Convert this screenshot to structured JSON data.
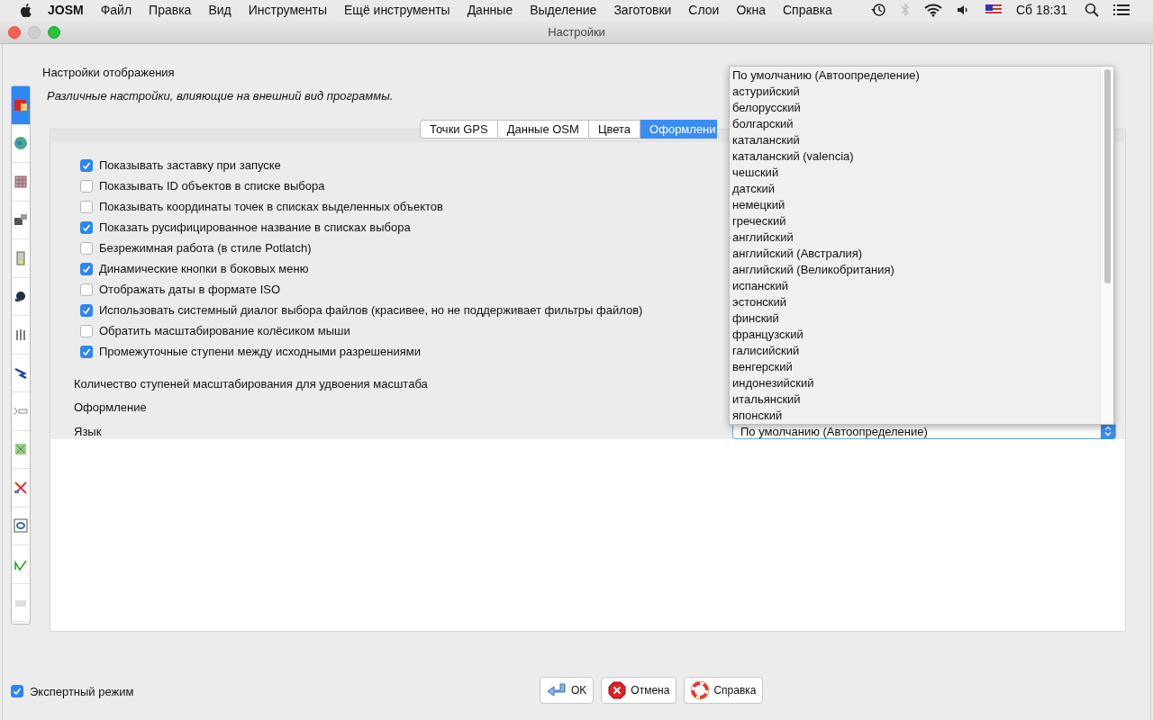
{
  "menu_bar": {
    "app": "JOSM",
    "items": [
      "Файл",
      "Правка",
      "Вид",
      "Инструменты",
      "Ещё инструменты",
      "Данные",
      "Выделение",
      "Заготовки",
      "Слои",
      "Окна",
      "Справка"
    ],
    "clock": "Сб 18:31"
  },
  "window": {
    "title": "Настройки"
  },
  "sidebar": {
    "items": [
      {
        "kind": "display",
        "selected": true
      },
      {
        "kind": "globe",
        "selected": false
      },
      {
        "kind": "grid",
        "selected": false
      },
      {
        "kind": "plugin",
        "selected": false
      },
      {
        "kind": "file",
        "selected": false
      },
      {
        "kind": "satellite",
        "selected": false
      },
      {
        "kind": "bars",
        "selected": false
      },
      {
        "kind": "arrow",
        "selected": false
      },
      {
        "kind": "dots",
        "selected": false
      },
      {
        "kind": "map",
        "selected": false
      },
      {
        "kind": "tools",
        "selected": false
      },
      {
        "kind": "ring",
        "selected": false
      },
      {
        "kind": "line",
        "selected": false
      },
      {
        "kind": "blank",
        "selected": false
      }
    ]
  },
  "header": {
    "title": "Настройки отображения",
    "description": "Различные настройки, влияющие на внешний вид программы."
  },
  "tabs": [
    {
      "label": "Точки GPS",
      "selected": false
    },
    {
      "label": "Данные OSM",
      "selected": false
    },
    {
      "label": "Цвета",
      "selected": false
    },
    {
      "label": "Оформлени",
      "selected": true
    }
  ],
  "options": [
    {
      "label": "Показывать заставку при запуске",
      "checked": true
    },
    {
      "label": "Показывать ID объектов в списке выбора",
      "checked": false
    },
    {
      "label": "Показывать координаты точек в списках выделенных объектов",
      "checked": false
    },
    {
      "label": "Показать русифицированное название в списках выбора",
      "checked": true
    },
    {
      "label": "Безрежимная работа (в стиле Potlatch)",
      "checked": false
    },
    {
      "label": "Динамические кнопки в боковых меню",
      "checked": true
    },
    {
      "label": "Отображать даты в формате ISO",
      "checked": false
    },
    {
      "label": "Использовать системный диалог выбора файлов (красивее, но не поддерживает фильтры файлов)",
      "checked": true
    },
    {
      "label": "Обратить масштабирование колёсиком мыши",
      "checked": false
    },
    {
      "label": "Промежуточные ступени между исходными разрешениями",
      "checked": true
    }
  ],
  "fields": [
    {
      "label": "Количество ступеней масштабирования для удвоения масштаба"
    },
    {
      "label": "Оформление"
    },
    {
      "label": "Язык",
      "value": "По умолчанию (Автоопределение)"
    }
  ],
  "language_list": [
    "По умолчанию (Автоопределение)",
    "астурийский",
    "белорусский",
    "болгарский",
    "каталанский",
    "каталанский (valencia)",
    "чешский",
    "датский",
    "немецкий",
    "греческий",
    "английский",
    "английский (Австралия)",
    "английский (Великобритания)",
    "испанский",
    "эстонский",
    "финский",
    "французский",
    "галисийский",
    "венгерский",
    "индонезийский",
    "итальянский",
    "японский"
  ],
  "expert_mode": {
    "label": "Экспертный режим",
    "checked": true
  },
  "buttons": [
    {
      "kind": "ok",
      "label": "OK"
    },
    {
      "kind": "cancel",
      "label": "Отмена"
    },
    {
      "kind": "help",
      "label": "Справка"
    }
  ]
}
